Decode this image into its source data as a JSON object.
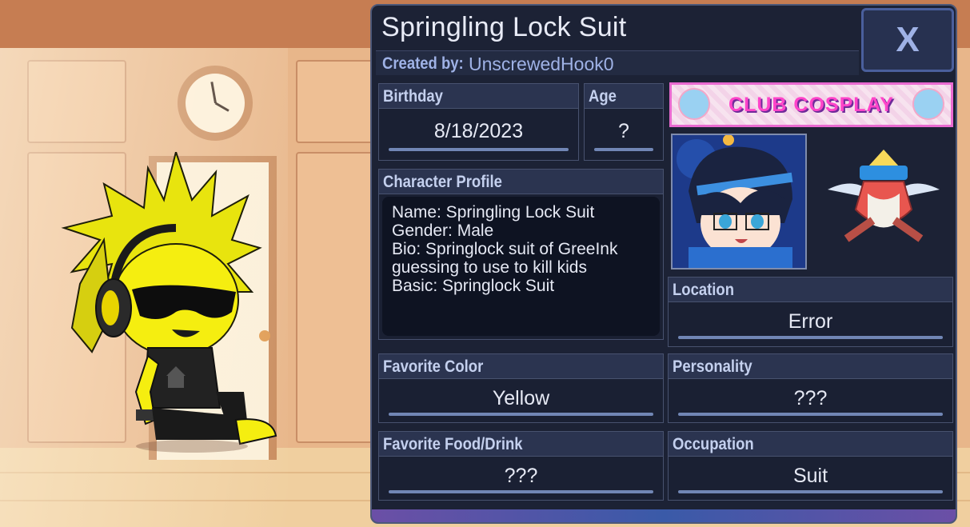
{
  "card": {
    "title": "Springling Lock Suit",
    "created_by_label": "Created by:",
    "creator": "UnscrewedHook0",
    "close_label": "X"
  },
  "fields": {
    "birthday": {
      "label": "Birthday",
      "value": "8/18/2023"
    },
    "age": {
      "label": "Age",
      "value": "?"
    },
    "profile": {
      "label": "Character Profile",
      "lines": [
        "Name: Springling Lock Suit",
        "Gender: Male",
        "Bio: Springlock suit of GreeInk",
        "guessing to use to kill kids",
        "Basic: Springlock Suit"
      ]
    },
    "location": {
      "label": "Location",
      "value": "Error"
    },
    "favorite_color": {
      "label": "Favorite Color",
      "value": "Yellow"
    },
    "personality": {
      "label": "Personality",
      "value": "???"
    },
    "favorite_food": {
      "label": "Favorite Food/Drink",
      "value": "???"
    },
    "occupation": {
      "label": "Occupation",
      "value": "Suit"
    }
  },
  "banner": {
    "text": "CLUB COSPLAY"
  },
  "icons": {
    "close": "close-icon",
    "portrait": "avatar",
    "emblem": "club-emblem-icon",
    "clock": "clock-icon",
    "headphones": "headphones-icon"
  },
  "colors": {
    "card_bg": "#1c2235",
    "accent": "#9fb2e6",
    "character_yellow": "#f5ee10",
    "banner_pink": "#ff44c9"
  }
}
